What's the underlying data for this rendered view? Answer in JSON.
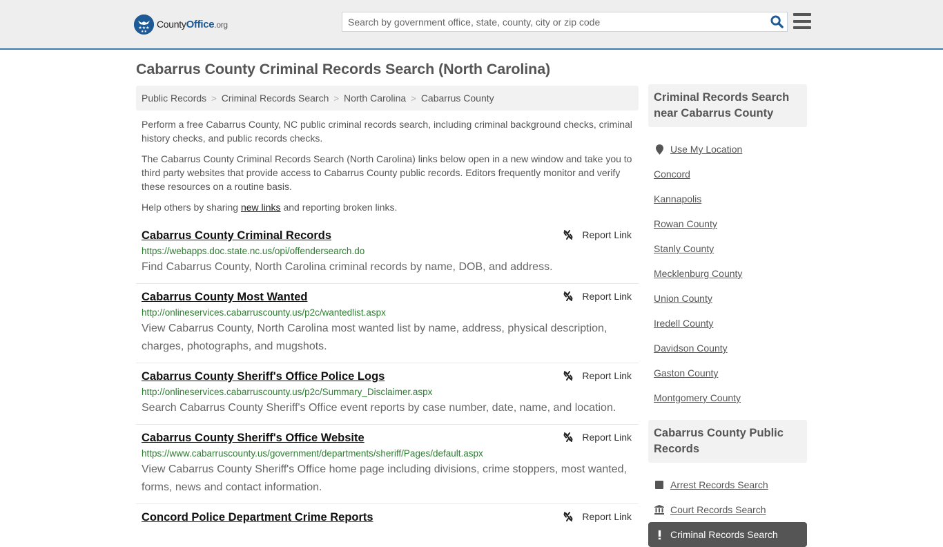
{
  "header": {
    "logo": {
      "county": "County",
      "office": "Office",
      "org": ".org"
    },
    "search": {
      "placeholder": "Search by government office, state, county, city or zip code",
      "value": ""
    },
    "brand_color": "#1d5a96",
    "border_color": "#3a7cad"
  },
  "page": {
    "title": "Cabarrus County Criminal Records Search (North Carolina)"
  },
  "breadcrumb": [
    {
      "label": "Public Records"
    },
    {
      "label": "Criminal Records Search"
    },
    {
      "label": "North Carolina"
    },
    {
      "label": "Cabarrus County"
    }
  ],
  "breadcrumb_separator": ">",
  "intro": {
    "p1": "Perform a free Cabarrus County, NC public criminal records search, including criminal background checks, criminal history checks, and public records checks.",
    "p2": "The Cabarrus County Criminal Records Search (North Carolina) links below open in a new window and take you to third party websites that provide access to Cabarrus County public records. Editors frequently monitor and verify these resources on a routine basis.",
    "p3_before": "Help others by sharing ",
    "p3_link": "new links",
    "p3_after": " and reporting broken links."
  },
  "results": [
    {
      "title": "Cabarrus County Criminal Records",
      "url": "https://webapps.doc.state.nc.us/opi/offendersearch.do",
      "description": "Find Cabarrus County, North Carolina criminal records by name, DOB, and address.",
      "report_label": "Report Link"
    },
    {
      "title": "Cabarrus County Most Wanted",
      "url": "http://onlineservices.cabarruscounty.us/p2c/wantedlist.aspx",
      "description": "View Cabarrus County, North Carolina most wanted list by name, address, physical description, charges, photographs, and mugshots.",
      "report_label": "Report Link"
    },
    {
      "title": "Cabarrus County Sheriff's Office Police Logs",
      "url": "http://onlineservices.cabarruscounty.us/p2c/Summary_Disclaimer.aspx",
      "description": "Search Cabarrus County Sheriff's Office event reports by case number, date, name, and location.",
      "report_label": "Report Link"
    },
    {
      "title": "Cabarrus County Sheriff's Office Website",
      "url": "https://www.cabarruscounty.us/government/departments/sheriff/Pages/default.aspx",
      "description": "View Cabarrus County Sheriff's Office home page including divisions, crime stoppers, most wanted, forms, news and contact information.",
      "report_label": "Report Link"
    },
    {
      "title": "Concord Police Department Crime Reports",
      "url": "",
      "description": "",
      "report_label": "Report Link"
    }
  ],
  "sidebar": {
    "nearby_heading": "Criminal Records Search near Cabarrus County",
    "use_location": "Use My Location",
    "nearby": [
      "Concord",
      "Kannapolis",
      "Rowan County",
      "Stanly County",
      "Mecklenburg County",
      "Union County",
      "Iredell County",
      "Davidson County",
      "Gaston County",
      "Montgomery County"
    ],
    "public_heading": "Cabarrus County Public Records",
    "public_records": [
      {
        "label": "Arrest Records Search",
        "icon": "square-icon"
      },
      {
        "label": "Court Records Search",
        "icon": "courthouse-icon"
      }
    ],
    "active_item": {
      "label": "Criminal Records Search",
      "icon": "exclamation-icon"
    }
  }
}
